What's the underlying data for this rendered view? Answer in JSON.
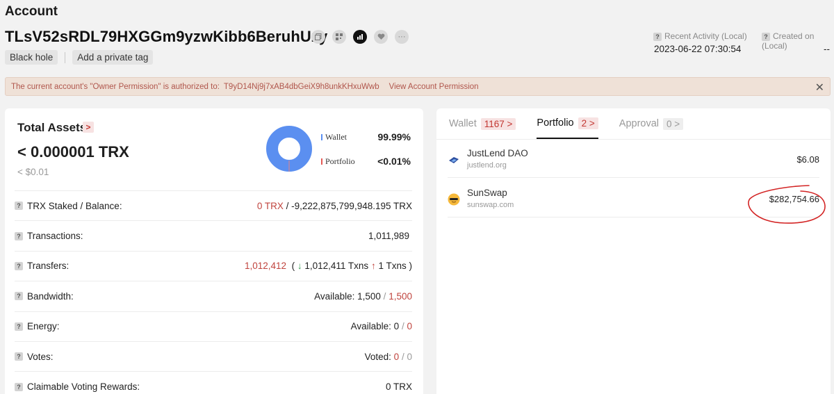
{
  "header": {
    "title": "Account",
    "address": "TLsV52sRDL79HXGGm9yzwKibb6BeruhUzy",
    "tags": [
      "Black hole",
      "Add a private tag"
    ],
    "recent_activity_label": "Recent Activity (Local)",
    "recent_activity_value": "2023-06-22 07:30:54",
    "created_on_label": "Created on (Local)",
    "created_on_value": "--",
    "icons": [
      "copy-icon",
      "qr-code-icon",
      "chart-icon",
      "heart-icon",
      "more-icon"
    ]
  },
  "notice": {
    "text": "The current account's \"Owner Permission\" is authorized to:",
    "authorized_address": "T9yD14Nj9j7xAB4dbGeiX9h8unkKHxuWwb",
    "link": "View Account Permission",
    "close": "✕"
  },
  "total_assets": {
    "title": "Total Assets",
    "chevron": ">",
    "amount": "< 0.000001 TRX",
    "usd": "< $0.01",
    "legend": [
      {
        "label": "Wallet",
        "value": "99.99%",
        "color": "#5b8ff0"
      },
      {
        "label": "Portfolio",
        "value": "<0.01%",
        "color": "#e55a56"
      }
    ]
  },
  "stats": {
    "staked_label": "TRX Staked / Balance",
    "staked_value": "0 TRX",
    "balance_value": "/ -9,222,875,799,948.195 TRX",
    "transactions_label": "Transactions",
    "transactions_value": "1,011,989",
    "transfers_label": "Transfers",
    "transfers_value": "1,012,412",
    "transfers_open": "(",
    "transfers_in": "1,012,411 Txns",
    "transfers_out": "1 Txns",
    "transfers_close": ")",
    "bandwidth_label": "Bandwidth",
    "bandwidth_available": "Available: 1,500",
    "bandwidth_total": "1,500",
    "energy_label": "Energy",
    "energy_available": "Available: 0",
    "energy_total": "0",
    "votes_label": "Votes",
    "votes_voted": "Voted:",
    "votes_value": "0",
    "votes_total": "0",
    "rewards_label": "Claimable Voting Rewards",
    "rewards_value": "0 TRX"
  },
  "tabs": [
    {
      "label": "Wallet",
      "count": "1167"
    },
    {
      "label": "Portfolio",
      "count": "2"
    },
    {
      "label": "Approval",
      "count": "0"
    }
  ],
  "portfolio": [
    {
      "name": "JustLend DAO",
      "site": "justlend.org",
      "amount": "$6.08"
    },
    {
      "name": "SunSwap",
      "site": "sunswap.com",
      "amount": "$282,754.66"
    }
  ]
}
